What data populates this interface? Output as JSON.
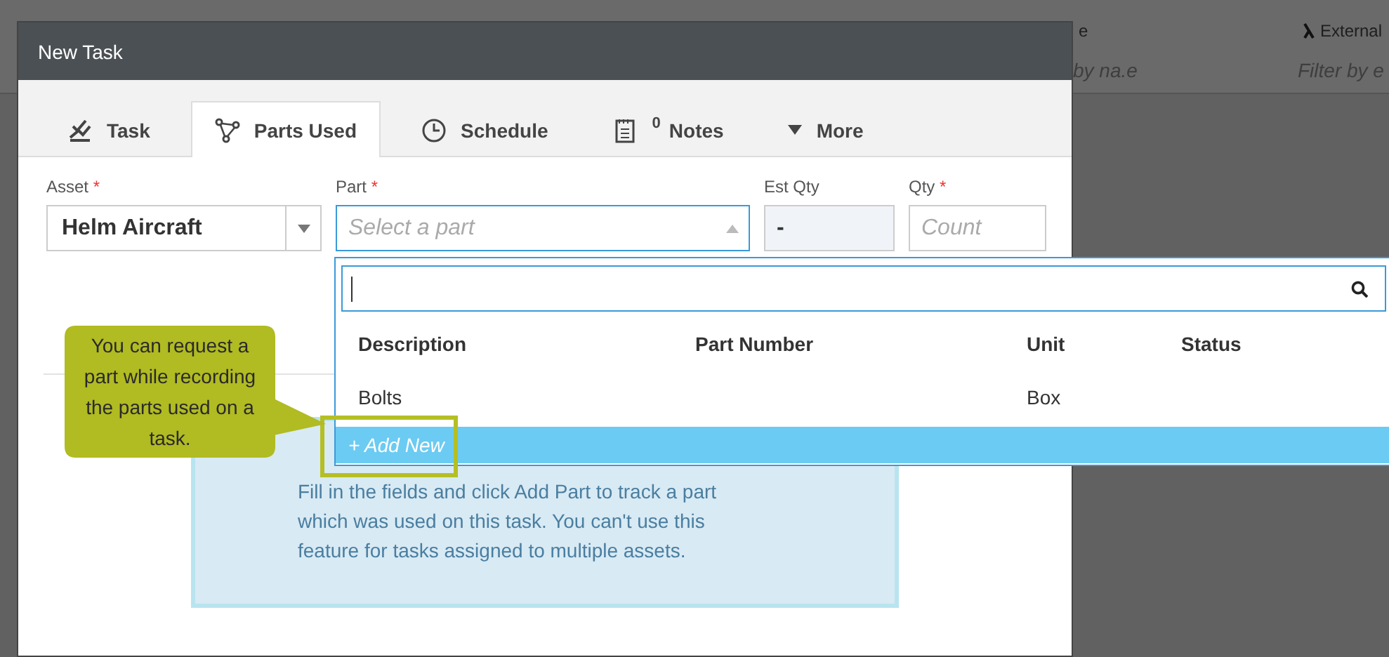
{
  "background": {
    "headers": [
      "e",
      "External"
    ],
    "filters": [
      "by na.e",
      "Filter by e"
    ]
  },
  "dialog": {
    "title": "New Task",
    "tabs": [
      {
        "label": "Task",
        "selected": false
      },
      {
        "label": "Parts Used",
        "selected": true
      },
      {
        "label": "Schedule",
        "selected": false
      },
      {
        "label": "Notes",
        "badge": "0",
        "selected": false
      },
      {
        "label": "More",
        "selected": false
      }
    ],
    "fields": [
      {
        "label": "Asset",
        "mark": "*",
        "kind": "select",
        "value": "Helm Aircraft"
      },
      {
        "label": "Part",
        "mark": "*",
        "kind": "combo",
        "placeholder": "Select a part"
      },
      {
        "label": "Est Qty",
        "kind": "readonly",
        "value": "-"
      },
      {
        "label": "Qty",
        "mark": "*",
        "kind": "input",
        "placeholder": "Count"
      }
    ],
    "info": "Fill in the fields and click Add Part to track a part which was used on this task. You can't use this feature for tasks assigned to multiple assets."
  },
  "dropdown": {
    "columns": [
      "Description",
      "Part Number",
      "Unit",
      "Status"
    ],
    "rows": [
      {
        "description": "Bolts",
        "unit": "Box"
      }
    ],
    "add_new": "+ Add New"
  },
  "tooltip": {
    "text": "You can request a part while recording the parts used on a task."
  }
}
